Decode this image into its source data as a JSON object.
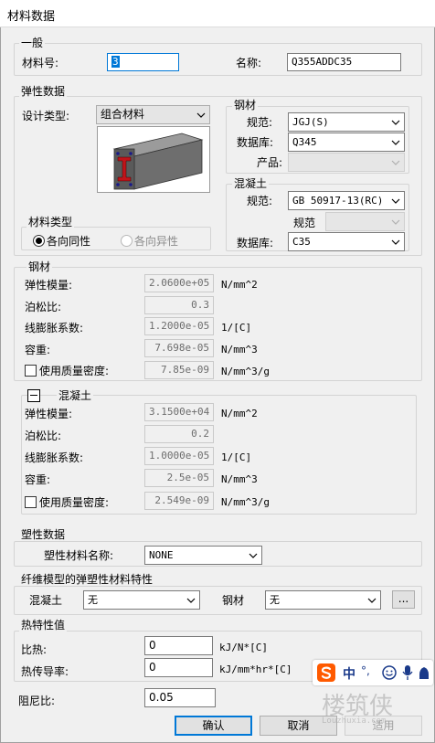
{
  "window": {
    "title": "材料数据"
  },
  "general": {
    "legend": "一般",
    "id_label": "材料号:",
    "id_value": "3",
    "name_label": "名称:",
    "name_value": "Q355ADDC35"
  },
  "elastic": {
    "legend": "弹性数据",
    "design_type_label": "设计类型:",
    "design_type_value": "组合材料",
    "material_type_legend": "材料类型",
    "isotropic_label": "各向同性",
    "anisotropic_label": "各向异性",
    "isotropic_selected": true
  },
  "steel_spec": {
    "legend": "钢材",
    "code_label": "规范:",
    "code_value": "JGJ(S)",
    "db_label": "数据库:",
    "db_value": "Q345",
    "product_label": "产品:",
    "product_value": ""
  },
  "concrete_spec": {
    "legend": "混凝土",
    "code_label": "规范:",
    "code_value": "GB 50917-13(RC)",
    "sub_code_label": "规范",
    "sub_code_value": "",
    "db_label": "数据库:",
    "db_value": "C35"
  },
  "steel_props": {
    "legend": "钢材",
    "rows": [
      {
        "label": "弹性模量:",
        "value": "2.0600e+05",
        "unit": "N/mm^2"
      },
      {
        "label": "泊松比:",
        "value": "0.3",
        "unit": ""
      },
      {
        "label": "线膨胀系数:",
        "value": "1.2000e-05",
        "unit": "1/[C]"
      },
      {
        "label": "容重:",
        "value": "7.698e-05",
        "unit": "N/mm^3"
      },
      {
        "label": "使用质量密度:",
        "value": "7.85e-09",
        "unit": "N/mm^3/g"
      }
    ]
  },
  "concrete_props": {
    "legend": "混凝土",
    "rows": [
      {
        "label": "弹性模量:",
        "value": "3.1500e+04",
        "unit": "N/mm^2"
      },
      {
        "label": "泊松比:",
        "value": "0.2",
        "unit": ""
      },
      {
        "label": "线膨胀系数:",
        "value": "1.0000e-05",
        "unit": "1/[C]"
      },
      {
        "label": "容重:",
        "value": "2.5e-05",
        "unit": "N/mm^3"
      },
      {
        "label": "使用质量密度:",
        "value": "2.549e-09",
        "unit": "N/mm^3/g"
      }
    ]
  },
  "plastic": {
    "legend": "塑性数据",
    "name_label": "塑性材料名称:",
    "name_value": "NONE"
  },
  "fiber": {
    "legend": "纤维模型的弹塑性材料特性",
    "concrete_label": "混凝土",
    "concrete_value": "无",
    "steel_label": "钢材",
    "steel_value": "无",
    "browse_label": "..."
  },
  "thermal": {
    "legend": "热特性值",
    "specific_heat_label": "比热:",
    "specific_heat_value": "0",
    "specific_heat_unit": "kJ/N*[C]",
    "conductivity_label": "热传导率:",
    "conductivity_value": "0",
    "conductivity_unit": "kJ/mm*hr*[C]"
  },
  "damping": {
    "label": "阻尼比:",
    "value": "0.05"
  },
  "buttons": {
    "ok": "确认",
    "cancel": "取消",
    "apply": "适用"
  },
  "ime": {
    "lang": "中",
    "punct": "°,"
  },
  "watermark": {
    "text": "楼筑侠",
    "sub": "Louzhuxia.com"
  },
  "colors": {
    "accent": "#0078d7",
    "ime_brand": "#ff5a00"
  }
}
